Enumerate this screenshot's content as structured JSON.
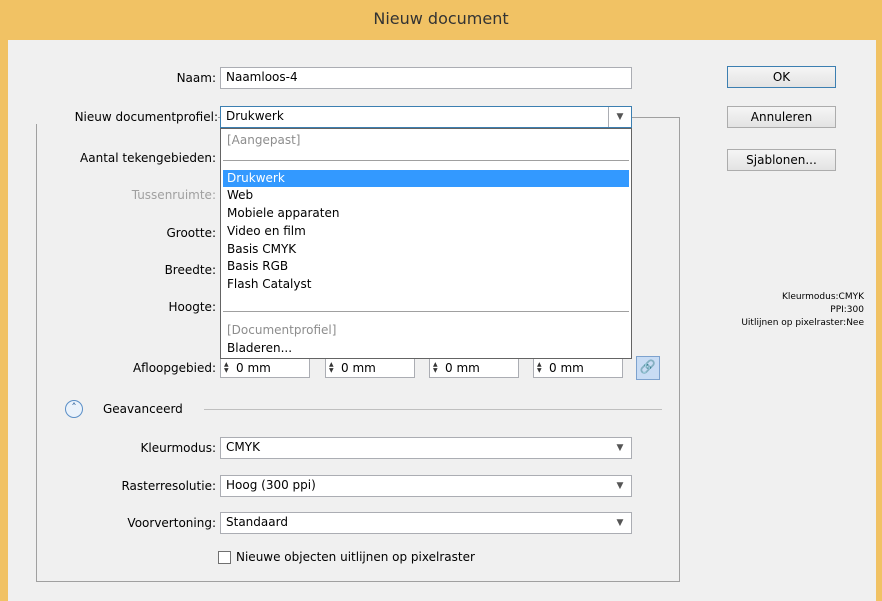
{
  "window": {
    "title": "Nieuw document"
  },
  "form": {
    "name_label": "Naam:",
    "name_value": "Naamloos-4",
    "profile_label": "Nieuw documentprofiel:",
    "profile_value": "Drukwerk",
    "artboards_label": "Aantal tekengebieden:",
    "spacing_label": "Tussenruimte:",
    "size_label": "Grootte:",
    "width_label": "Breedte:",
    "height_label": "Hoogte:",
    "bleed_label": "Afloopgebied:",
    "bleed_values": [
      "0 mm",
      "0 mm",
      "0 mm",
      "0 mm"
    ]
  },
  "profile_dropdown": {
    "items_top": [
      "[Aangepast]"
    ],
    "items_main": [
      "Drukwerk",
      "Web",
      "Mobiele apparaten",
      "Video en film",
      "Basis CMYK",
      "Basis RGB",
      "Flash Catalyst"
    ],
    "selected": "Drukwerk",
    "items_bottom": [
      "[Documentprofiel]",
      "Bladeren..."
    ]
  },
  "buttons": {
    "ok": "OK",
    "cancel": "Annuleren",
    "templates": "Sjablonen..."
  },
  "info": {
    "color_mode": "Kleurmodus:CMYK",
    "ppi": "PPI:300",
    "pixel_align": "Uitlijnen op pixelraster:Nee"
  },
  "advanced": {
    "title": "Geavanceerd",
    "color_mode_label": "Kleurmodus:",
    "color_mode_value": "CMYK",
    "raster_label": "Rasterresolutie:",
    "raster_value": "Hoog (300 ppi)",
    "preview_label": "Voorvertoning:",
    "preview_value": "Standaard",
    "align_checkbox_label": "Nieuwe objecten uitlijnen op pixelraster",
    "align_checked": false
  }
}
